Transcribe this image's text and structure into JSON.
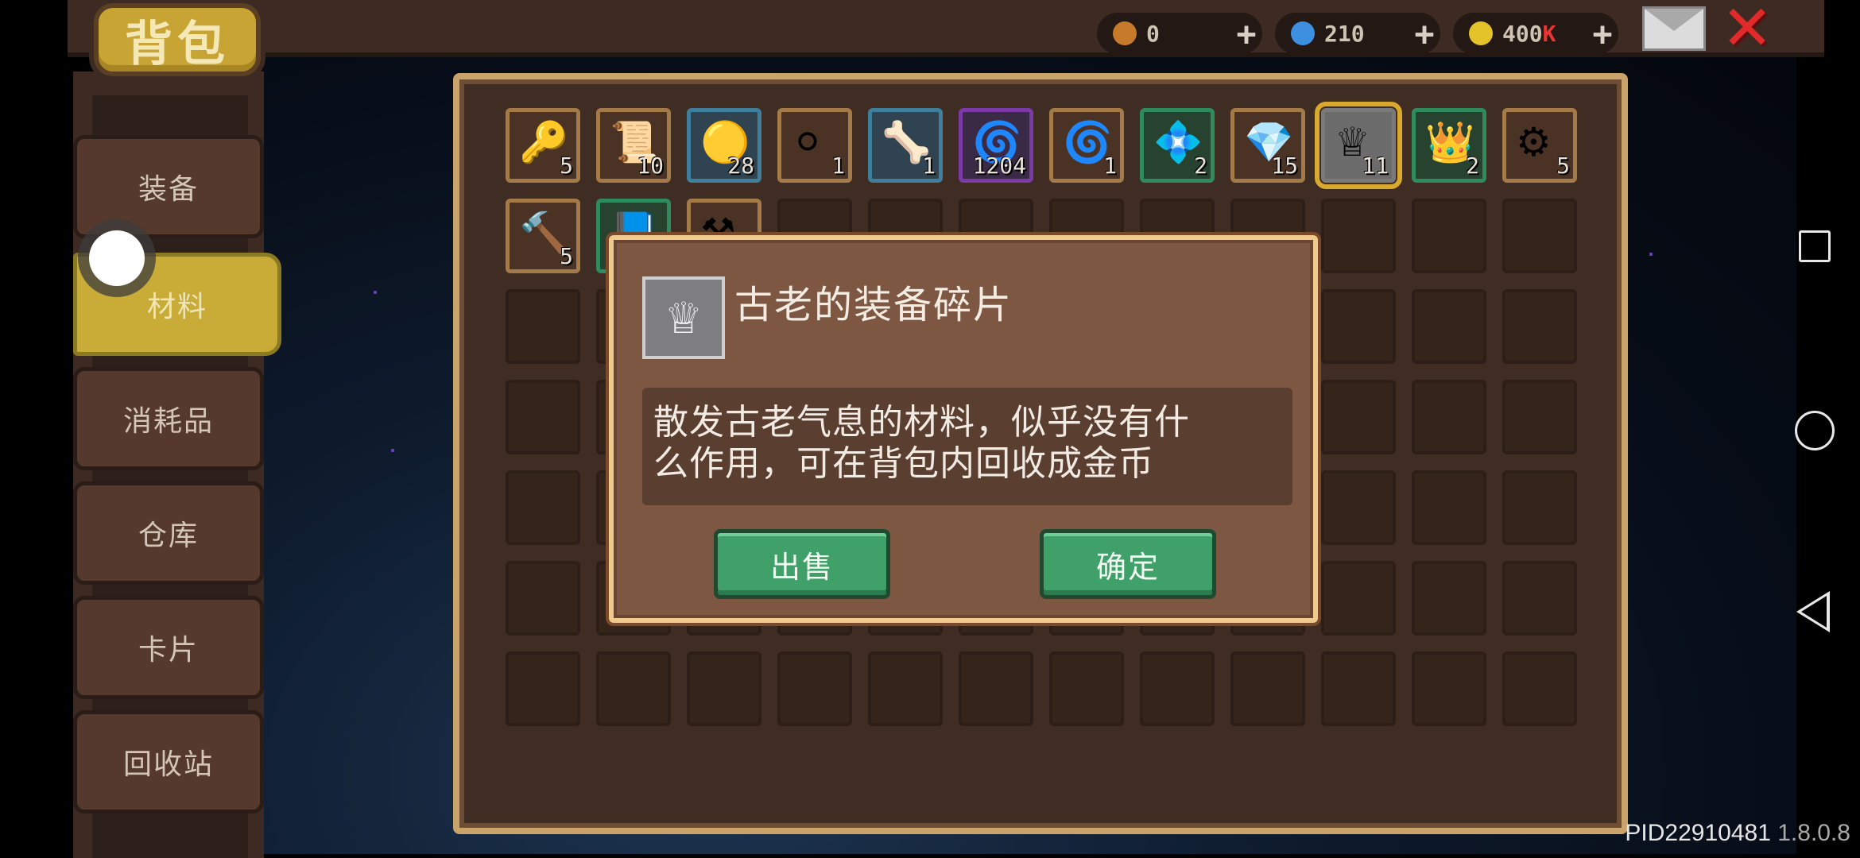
{
  "title": "背包",
  "currencies": [
    {
      "icon": "potion-icon",
      "value": "0",
      "color": "#c77a2a"
    },
    {
      "icon": "gem-icon",
      "value": "210",
      "color": "#3d8fe0"
    },
    {
      "icon": "coin-icon",
      "value": "400",
      "suffix": "K",
      "color": "#e3c22a"
    }
  ],
  "plus_label": "+",
  "close_label": "✕",
  "tabs": [
    {
      "label": "装备"
    },
    {
      "label": "材料"
    },
    {
      "label": "消耗品"
    },
    {
      "label": "仓库"
    },
    {
      "label": "卡片"
    },
    {
      "label": "回收站"
    }
  ],
  "inventory": {
    "items": [
      {
        "icon": "key-icon",
        "glyph": "🔑",
        "qty": "5",
        "frame": "brown"
      },
      {
        "icon": "scroll-icon",
        "glyph": "📜",
        "qty": "10",
        "frame": "brown"
      },
      {
        "icon": "gold-scroll-icon",
        "glyph": "🟡",
        "qty": "28",
        "frame": "blue"
      },
      {
        "icon": "orb-icon",
        "glyph": "⚪",
        "qty": "1",
        "frame": "brown"
      },
      {
        "icon": "bone-icon",
        "glyph": "🦴",
        "qty": "1",
        "frame": "blue"
      },
      {
        "icon": "spiral-shell-icon",
        "glyph": "🌀",
        "qty": "1204",
        "frame": "purple"
      },
      {
        "icon": "vortex-icon",
        "glyph": "🌀",
        "qty": "1",
        "frame": "brown"
      },
      {
        "icon": "dark-crystal-icon",
        "glyph": "💠",
        "qty": "2",
        "frame": "green"
      },
      {
        "icon": "prism-ore-icon",
        "glyph": "💎",
        "qty": "15",
        "frame": "brown"
      },
      {
        "icon": "ancient-fragment-icon",
        "glyph": "♕",
        "qty": "11",
        "frame": "gray",
        "selected": true
      },
      {
        "icon": "fire-crown-icon",
        "glyph": "👑",
        "qty": "2",
        "frame": "green"
      },
      {
        "icon": "flower-gear-icon",
        "glyph": "⚙",
        "qty": "5",
        "frame": "brown"
      },
      {
        "icon": "hammer-icon",
        "glyph": "🔨",
        "qty": "5",
        "frame": "brown"
      },
      {
        "icon": "book-icon",
        "glyph": "📘",
        "qty": "",
        "frame": "green"
      },
      {
        "icon": "anvil-icon",
        "glyph": "⚒",
        "qty": "",
        "frame": "brown"
      }
    ],
    "total_slots": 84
  },
  "dialog": {
    "icon": "ancient-fragment-icon",
    "icon_glyph": "♕",
    "title": "古老的装备碎片",
    "description_line1": "散发古老气息的材料，似乎没有什",
    "description_line2": "么作用，可在背包内回收成金币",
    "sell_label": "出售",
    "confirm_label": "确定"
  },
  "footer": {
    "pid": "PID22910481",
    "version": "1.8.0.8"
  }
}
